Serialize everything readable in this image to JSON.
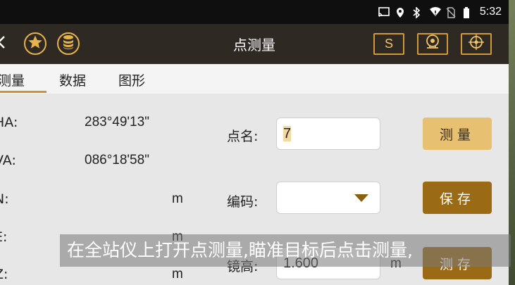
{
  "status_bar": {
    "time": "5:32",
    "icons": [
      "cast-icon",
      "location-icon",
      "bluetooth-icon",
      "wifi-icon",
      "no-sim-icon",
      "battery-icon"
    ]
  },
  "title_bar": {
    "title": "点测量",
    "s_button_label": "S",
    "icons": [
      "back-icon",
      "star-icon",
      "database-icon",
      "instrument-icon",
      "target-icon"
    ],
    "accent_color": "#e6b34a"
  },
  "tabs": [
    {
      "label": "测量",
      "active": true
    },
    {
      "label": "数据",
      "active": false
    },
    {
      "label": "图形",
      "active": false
    }
  ],
  "measure": {
    "ha_label": "HA:",
    "ha_value": "283°49'13\"",
    "va_label": "VA:",
    "va_value": "086°18'58\"",
    "n_label": "N:",
    "n_unit": "m",
    "e_label": "E:",
    "e_unit": "m",
    "z_label": "Z:",
    "z_unit": "m"
  },
  "form": {
    "point_name_label": "点名:",
    "point_name_value": "7",
    "code_label": "编码:",
    "code_value": "",
    "mirror_height_label": "镜高:",
    "mirror_height_value": "1.600",
    "mirror_height_unit": "m"
  },
  "buttons": {
    "measure": "测量",
    "save": "保存",
    "measure_save": "测存"
  },
  "subtitle": "在全站仪上打开点测量,瞄准目标后点击测量,"
}
